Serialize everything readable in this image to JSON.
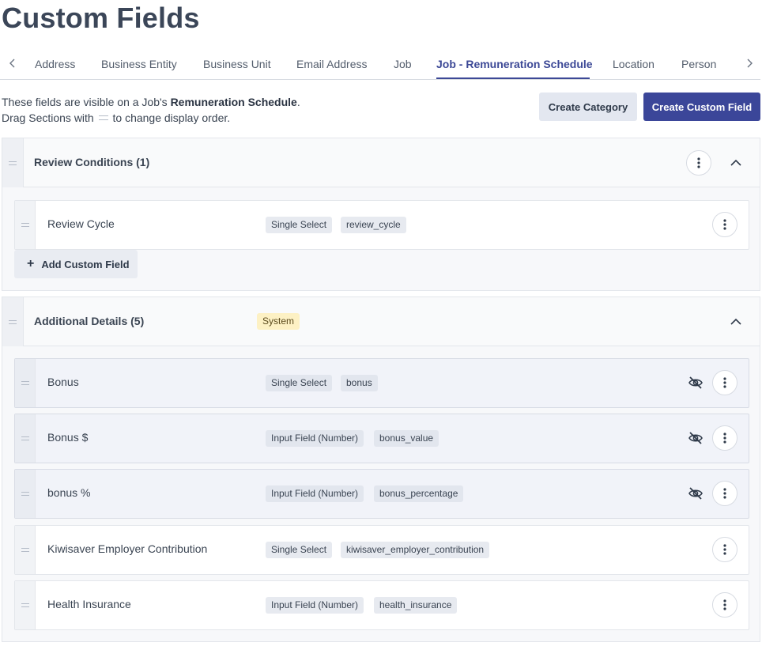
{
  "page": {
    "title": "Custom Fields"
  },
  "tabs": {
    "items": [
      {
        "label": "Address",
        "active": false
      },
      {
        "label": "Business Entity",
        "active": false
      },
      {
        "label": "Business Unit",
        "active": false
      },
      {
        "label": "Email Address",
        "active": false
      },
      {
        "label": "Job",
        "active": false
      },
      {
        "label": "Job - Remuneration Schedule",
        "active": true
      },
      {
        "label": "Location",
        "active": false
      },
      {
        "label": "Person",
        "active": false
      }
    ],
    "prev_icon": "chevron-left-icon",
    "next_icon": "chevron-right-icon"
  },
  "intro": {
    "line1_prefix": "These fields are visible on a Job's ",
    "line1_bold": "Remuneration Schedule",
    "line1_suffix": ".",
    "line2_prefix": "Drag Sections with",
    "line2_suffix": "to change display order."
  },
  "actions": {
    "create_category": "Create Category",
    "create_custom_field": "Create Custom Field"
  },
  "colors": {
    "accent": "#3b4699",
    "system_badge_bg": "#fdf1c4",
    "hidden_row_bg": "#f1f3f9"
  },
  "sections": [
    {
      "title": "Review Conditions (1)",
      "badge": "",
      "fields": [
        {
          "name": "Review Cycle",
          "type": "Single Select",
          "key": "review_cycle",
          "hidden": false
        }
      ],
      "add_label": "Add Custom Field"
    },
    {
      "title": "Additional Details (5)",
      "badge": "System",
      "fields": [
        {
          "name": "Bonus",
          "type": "Single Select",
          "key": "bonus",
          "hidden": true
        },
        {
          "name": "Bonus $",
          "type": "Input Field (Number)",
          "key": "bonus_value",
          "hidden": true
        },
        {
          "name": "bonus %",
          "type": "Input Field (Number)",
          "key": "bonus_percentage",
          "hidden": true
        },
        {
          "name": "Kiwisaver Employer Contribution",
          "type": "Single Select",
          "key": "kiwisaver_employer_contribution",
          "hidden": false
        },
        {
          "name": "Health Insurance",
          "type": "Input Field (Number)",
          "key": "health_insurance",
          "hidden": false
        }
      ]
    }
  ]
}
